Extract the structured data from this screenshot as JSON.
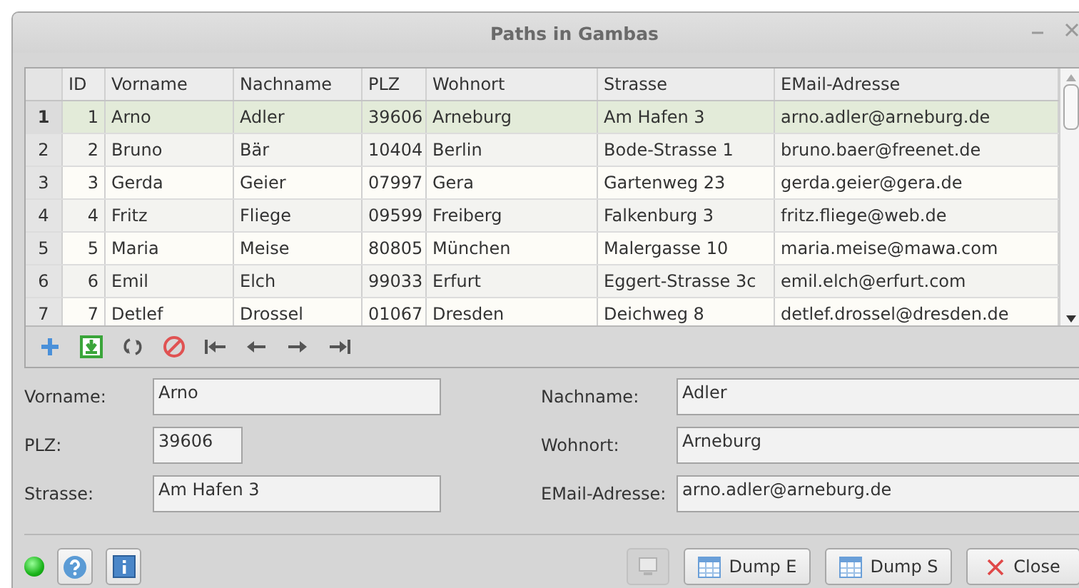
{
  "window": {
    "title": "Paths in Gambas"
  },
  "table": {
    "columns": [
      "",
      "ID",
      "Vorname",
      "Nachname",
      "PLZ",
      "Wohnort",
      "Strasse",
      "EMail-Adresse"
    ],
    "rows": [
      {
        "selected": true,
        "cells": [
          "1",
          "1",
          "Arno",
          "Adler",
          "39606",
          "Arneburg",
          "Am Hafen 3",
          "arno.adler@arneburg.de"
        ]
      },
      {
        "selected": false,
        "cells": [
          "2",
          "2",
          "Bruno",
          "Bär",
          "10404",
          "Berlin",
          "Bode-Strasse 1",
          "bruno.baer@freenet.de"
        ]
      },
      {
        "selected": false,
        "cells": [
          "3",
          "3",
          "Gerda",
          "Geier",
          "07997",
          "Gera",
          "Gartenweg 23",
          "gerda.geier@gera.de"
        ]
      },
      {
        "selected": false,
        "cells": [
          "4",
          "4",
          "Fritz",
          "Fliege",
          "09599",
          "Freiberg",
          "Falkenburg 3",
          "fritz.fliege@web.de"
        ]
      },
      {
        "selected": false,
        "cells": [
          "5",
          "5",
          "Maria",
          "Meise",
          "80805",
          "München",
          "Malergasse 10",
          "maria.meise@mawa.com"
        ]
      },
      {
        "selected": false,
        "cells": [
          "6",
          "6",
          "Emil",
          "Elch",
          "99033",
          "Erfurt",
          "Eggert-Strasse 3c",
          "emil.elch@erfurt.com"
        ]
      },
      {
        "selected": false,
        "cells": [
          "7",
          "7",
          "Detlef",
          "Drossel",
          "01067",
          "Dresden",
          "Deichweg 8",
          "detlef.drossel@dresden.de"
        ]
      }
    ]
  },
  "toolbar": [
    {
      "kind": "add"
    },
    {
      "kind": "save"
    },
    {
      "kind": "refresh"
    },
    {
      "kind": "cancel"
    },
    {
      "kind": "first"
    },
    {
      "kind": "previous"
    },
    {
      "kind": "next"
    },
    {
      "kind": "last"
    }
  ],
  "form": [
    {
      "label": "Vorname:",
      "value": "Arno",
      "kind": "wide"
    },
    {
      "label": "Nachname:",
      "value": "Adler",
      "kind": "wide"
    },
    {
      "label": "PLZ:",
      "value": "39606",
      "kind": "short"
    },
    {
      "label": "Wohnort:",
      "value": "Arneburg",
      "kind": "wide"
    },
    {
      "label": "Strasse:",
      "value": "Am Hafen 3",
      "kind": "wide"
    },
    {
      "label": "EMail-Adresse:",
      "value": "arno.adler@arneburg.de",
      "kind": "wide"
    }
  ],
  "footer": {
    "status_led": {
      "on": true
    },
    "left_buttons": [
      {
        "kind": "help"
      },
      {
        "kind": "info"
      }
    ],
    "buttons": [
      {
        "kind": "monitor",
        "disabled": true
      },
      {
        "kind": "table",
        "label": "Dump E",
        "disabled": false
      },
      {
        "kind": "table",
        "label": "Dump S",
        "disabled": false
      },
      {
        "kind": "close",
        "label": "Close",
        "disabled": false
      }
    ]
  }
}
